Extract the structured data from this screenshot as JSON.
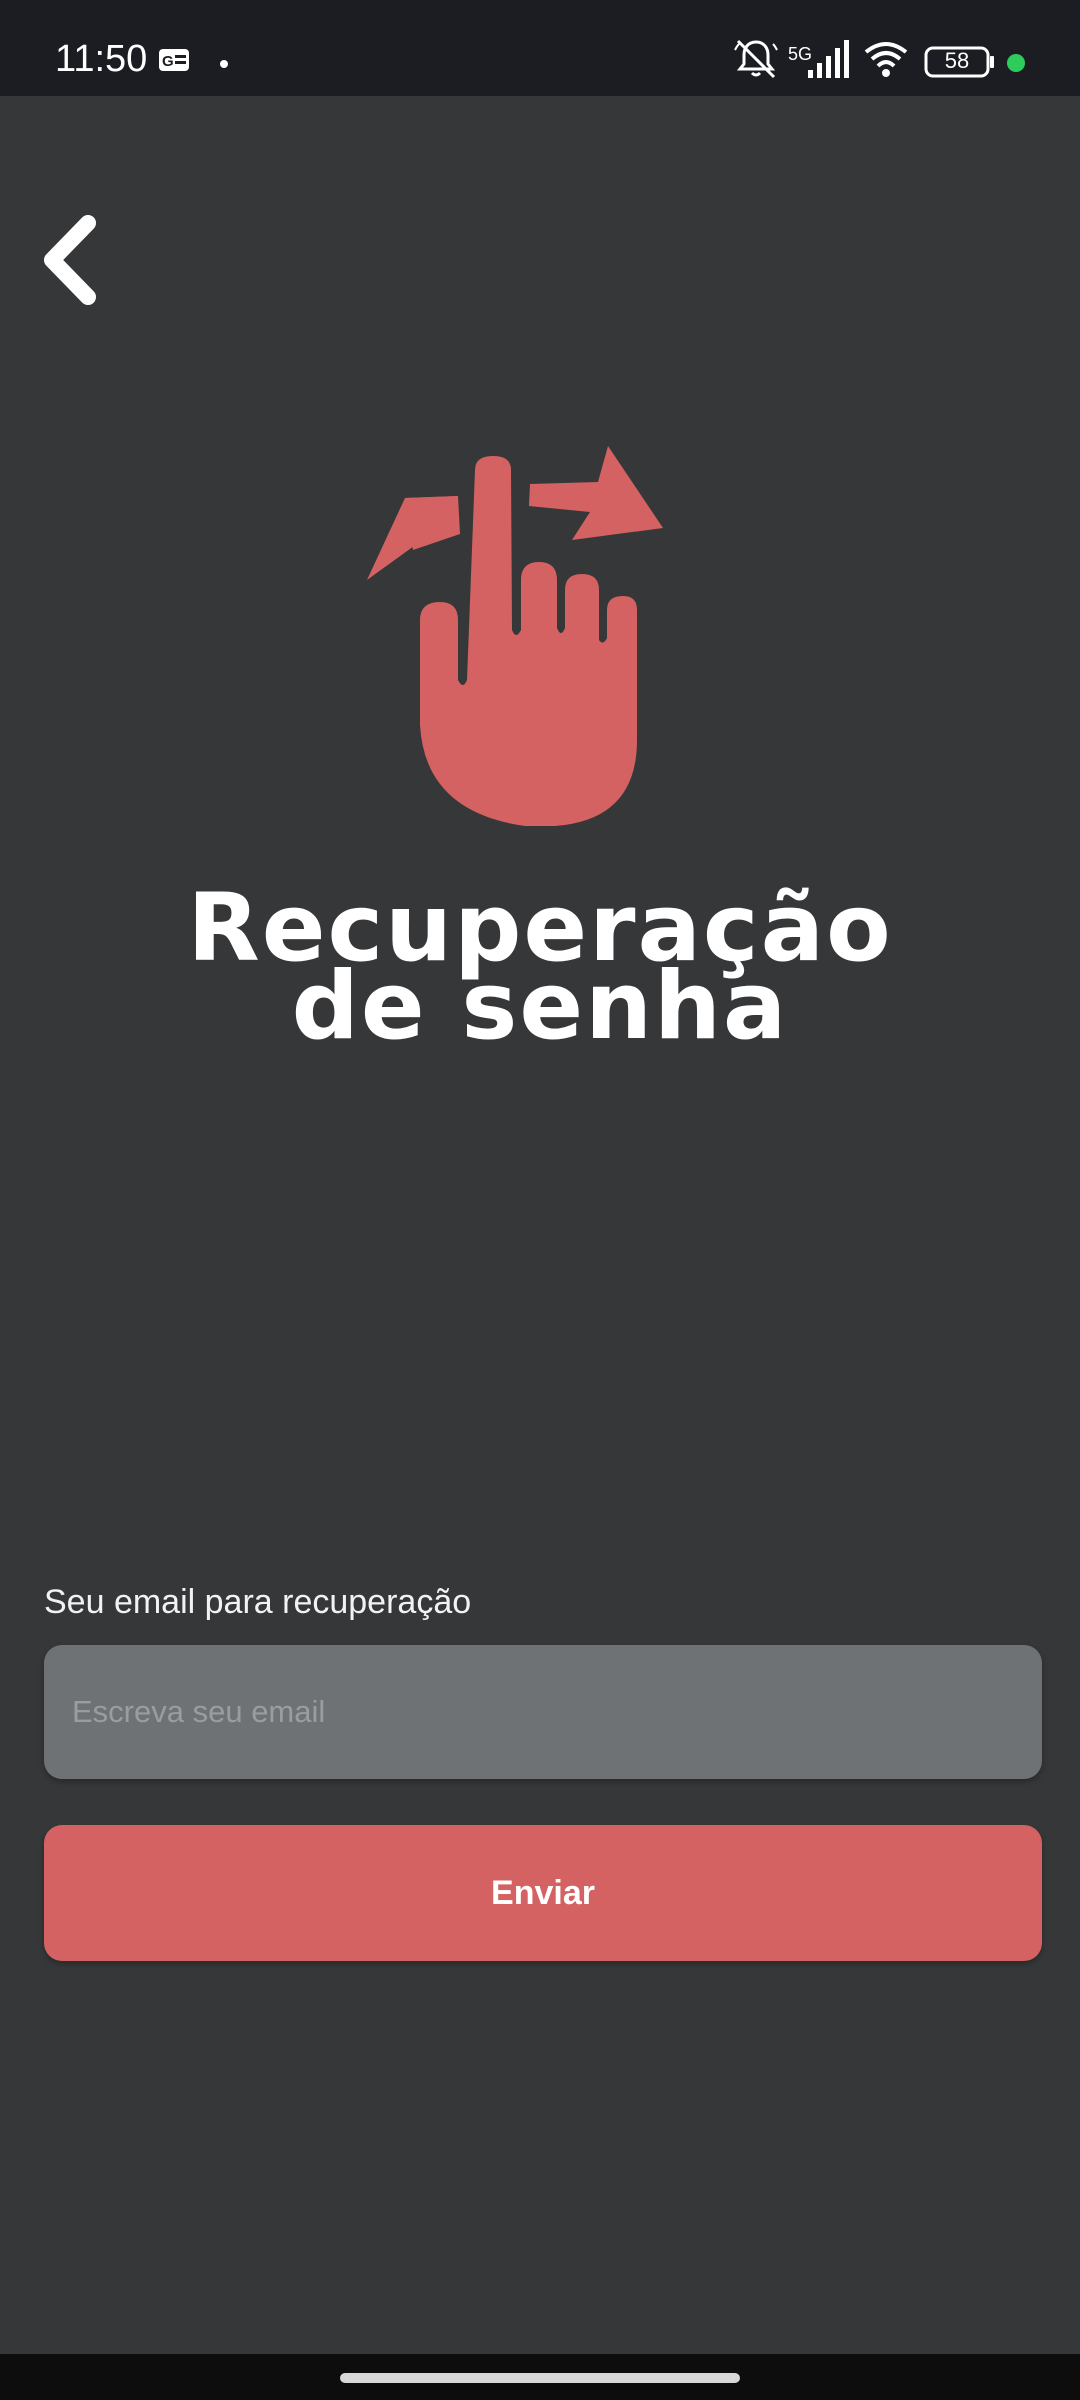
{
  "status_bar": {
    "time": "11:50",
    "network": "5G",
    "battery": "58",
    "icons": [
      "card-icon",
      "dot-icon",
      "mute-icon",
      "signal-icon",
      "wifi-icon",
      "battery-icon",
      "active-dot-icon"
    ],
    "active_dot_color": "#2ecc5b"
  },
  "header": {
    "back_icon": "chevron-left-icon"
  },
  "hero": {
    "icon": "swipe-hand-icon",
    "color": "#d46262"
  },
  "title": {
    "line1": "Recuperação",
    "line2": "de senha"
  },
  "form": {
    "email_label": "Seu email para recuperação",
    "email_placeholder": "Escreva seu email",
    "email_value": "",
    "submit_label": "Enviar"
  },
  "colors": {
    "background": "#363739",
    "accent": "#d46262",
    "input_bg": "#6f7274"
  }
}
